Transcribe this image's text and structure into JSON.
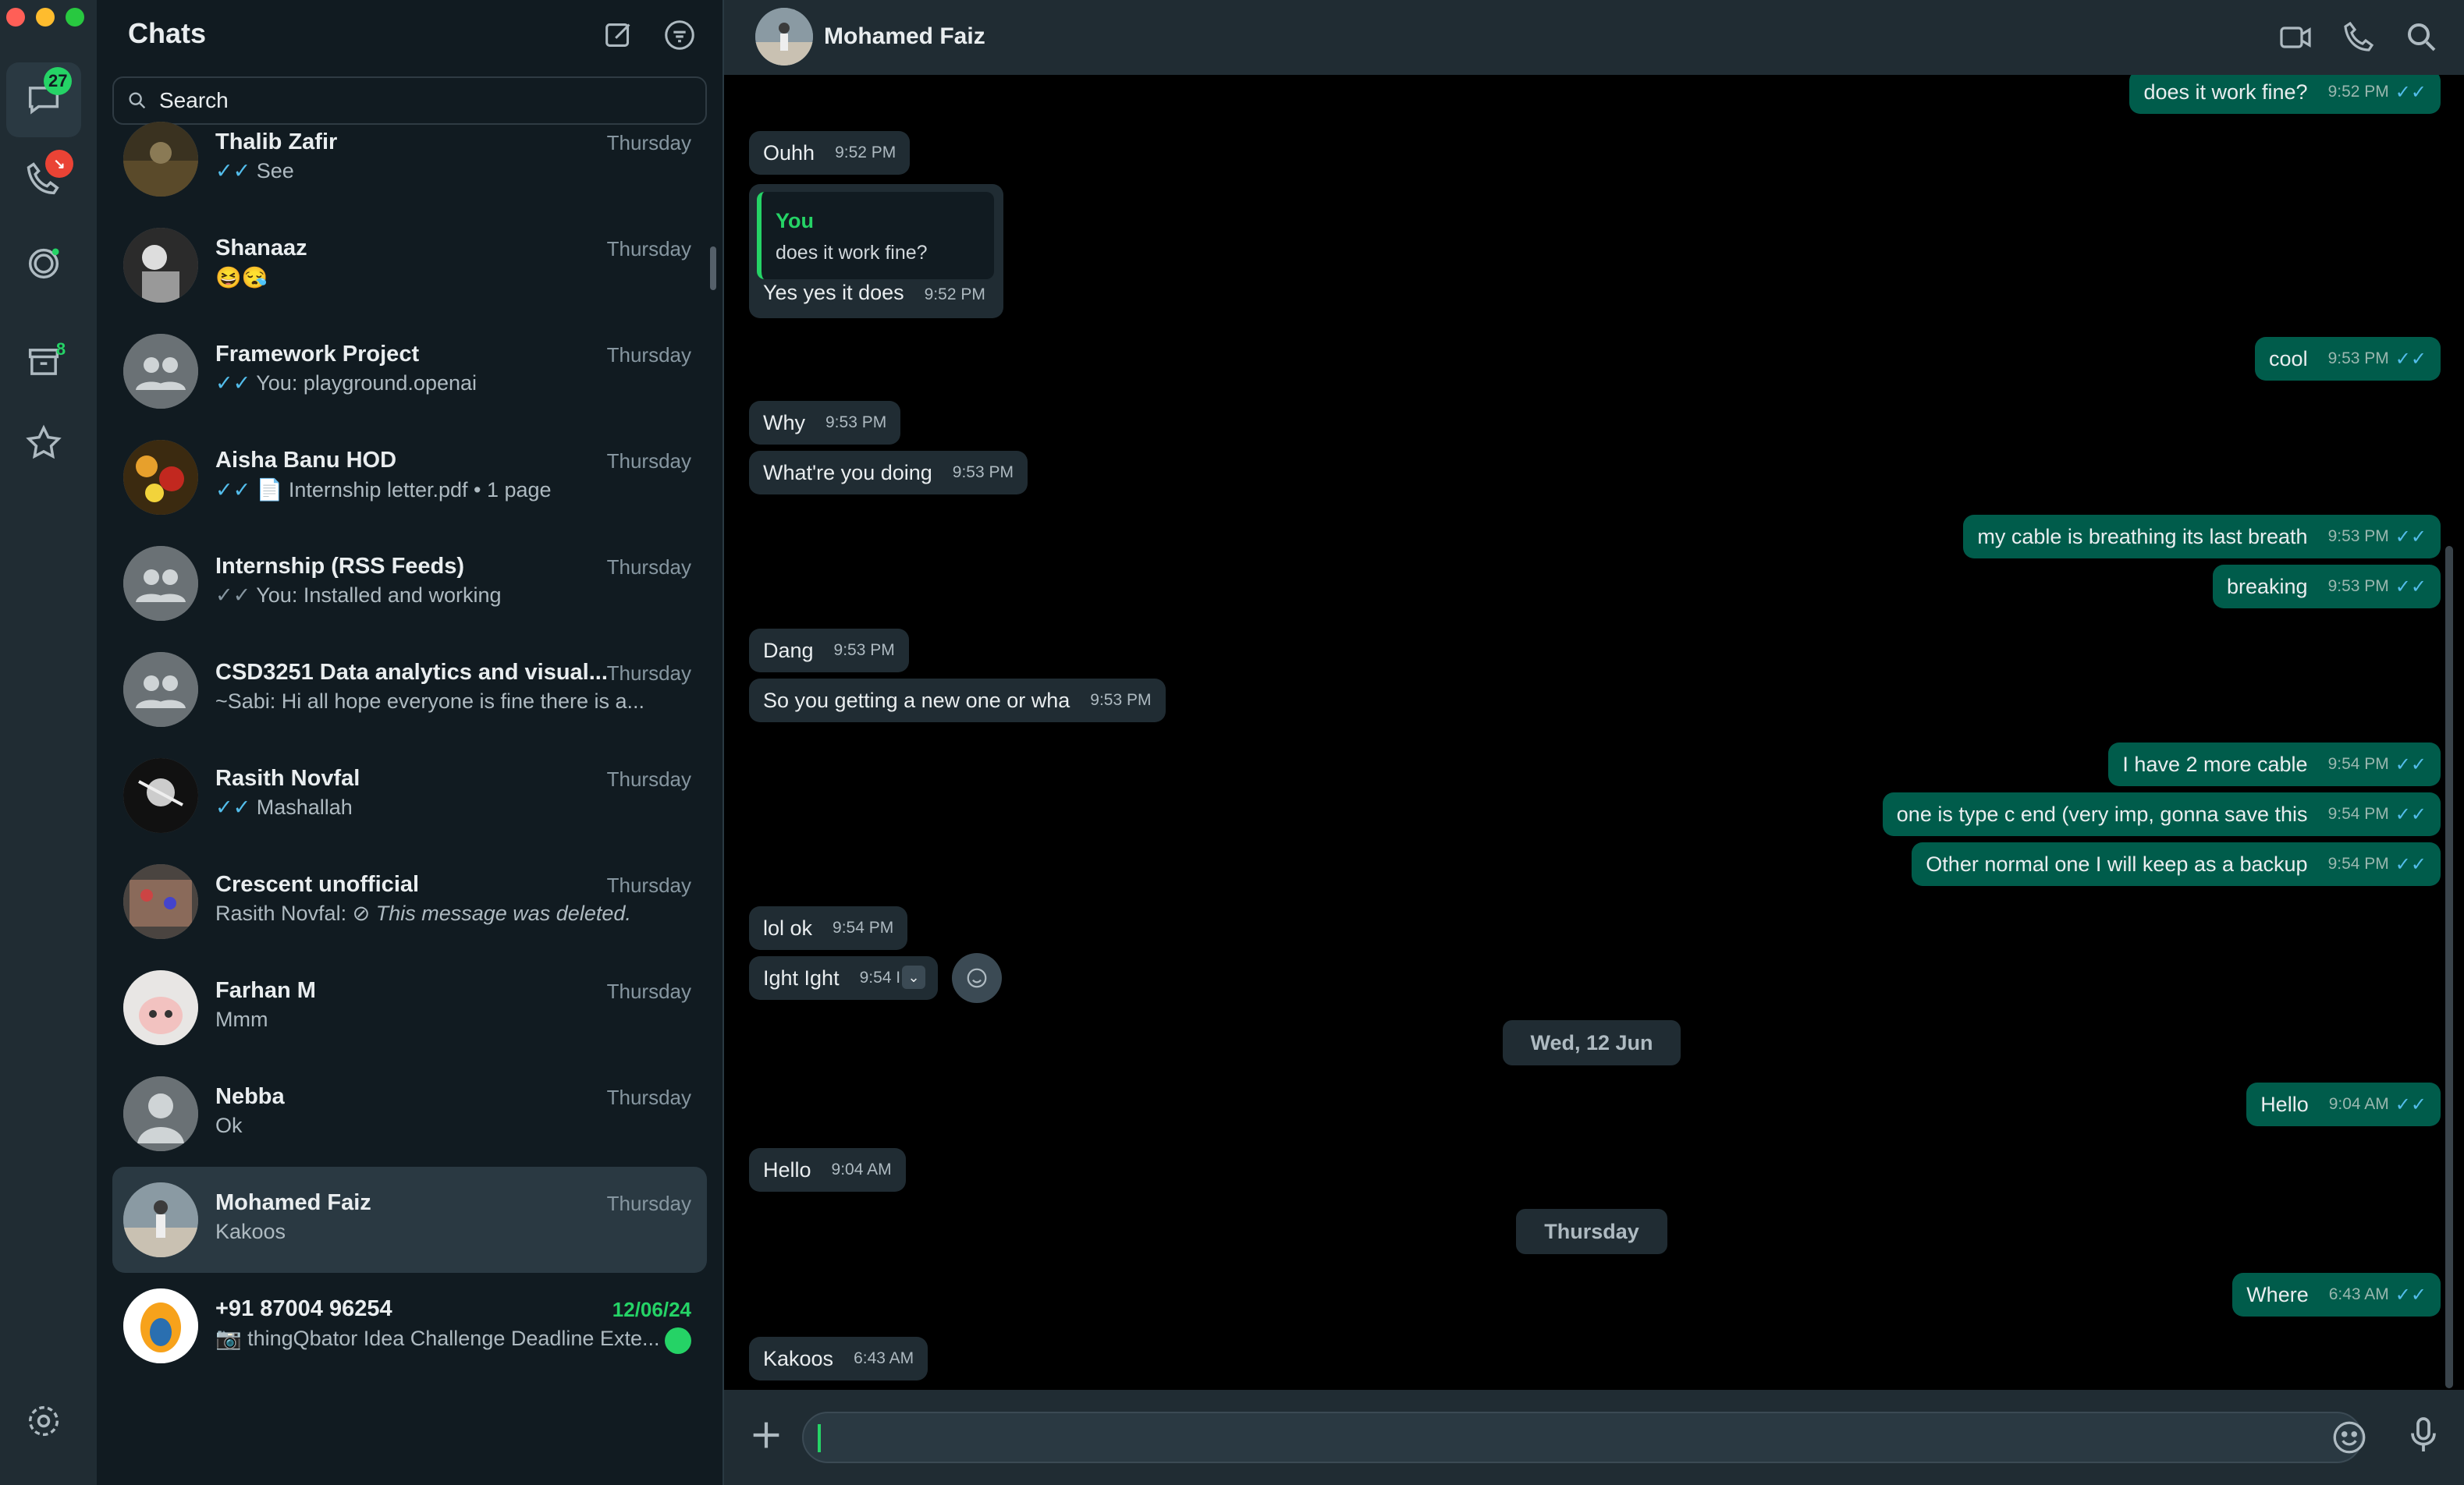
{
  "window": {
    "traffic_lights": [
      "#ff5f57",
      "#febc2e",
      "#28c840"
    ]
  },
  "rail": {
    "chats_badge": "27",
    "calls_badge": "↘",
    "archive_badge": "8",
    "items": [
      "chats-icon",
      "calls-icon",
      "status-icon",
      "archive-icon",
      "starred-icon",
      "settings-icon"
    ]
  },
  "list": {
    "title": "Chats",
    "search_placeholder": "Search",
    "chats": [
      {
        "name": "Thalib Zafir",
        "time": "Thursday",
        "tick": "✓✓",
        "tick_color": "blue",
        "preview": "See"
      },
      {
        "name": "Shanaaz",
        "time": "Thursday",
        "tick": "",
        "tick_color": "",
        "preview": "😆😪"
      },
      {
        "name": "Framework Project",
        "time": "Thursday",
        "tick": "✓✓",
        "tick_color": "blue",
        "preview": "You: playground.openai"
      },
      {
        "name": "Aisha Banu HOD",
        "time": "Thursday",
        "tick": "✓✓",
        "tick_color": "blue",
        "preview": "📄 Internship letter.pdf • 1 page"
      },
      {
        "name": "Internship (RSS Feeds)",
        "time": "Thursday",
        "tick": "✓✓",
        "tick_color": "grey",
        "preview": "You: Installed and working"
      },
      {
        "name": "CSD3251 Data analytics and visual...",
        "time": "Thursday",
        "tick": "",
        "tick_color": "",
        "preview": "~Sabi: Hi all hope everyone is fine there is a..."
      },
      {
        "name": "Rasith Novfal",
        "time": "Thursday",
        "tick": "✓✓",
        "tick_color": "blue",
        "preview": "Mashallah"
      },
      {
        "name": "Crescent unofficial",
        "time": "Thursday",
        "tick": "",
        "tick_color": "",
        "preview_prefix": "Rasith Novfal: ⊘ ",
        "preview": "This message was deleted."
      },
      {
        "name": "Farhan M",
        "time": "Thursday",
        "tick": "",
        "tick_color": "",
        "preview": "Mmm"
      },
      {
        "name": "Nebba",
        "time": "Thursday",
        "tick": "",
        "tick_color": "",
        "preview": "Ok"
      },
      {
        "name": "Mohamed Faiz",
        "time": "Thursday",
        "tick": "",
        "tick_color": "",
        "preview": "Kakoos"
      },
      {
        "name": "+91 87004 96254",
        "time": "12/06/24",
        "tick": "",
        "tick_color": "",
        "preview": "📷 thingQbator Idea Challenge Deadline Exte..."
      }
    ]
  },
  "conversation": {
    "contact_name": "Mohamed Faiz",
    "messages": [
      {
        "dir": "out",
        "text": "does it work fine?",
        "time": "9:52 PM"
      },
      {
        "dir": "in",
        "text": "Ouhh",
        "time": "9:52 PM"
      },
      {
        "dir": "in",
        "text": "Yes yes it does",
        "time": "9:52 PM",
        "quote_author": "You",
        "quote_text": "does it work fine?"
      },
      {
        "dir": "out",
        "text": "cool",
        "time": "9:53 PM"
      },
      {
        "dir": "in",
        "text": "Why",
        "time": "9:53 PM"
      },
      {
        "dir": "in",
        "text": "What're you doing",
        "time": "9:53 PM"
      },
      {
        "dir": "out",
        "text": "my cable is breathing its last breath",
        "time": "9:53 PM"
      },
      {
        "dir": "out",
        "text": "breaking",
        "time": "9:53 PM"
      },
      {
        "dir": "in",
        "text": "Dang",
        "time": "9:53 PM"
      },
      {
        "dir": "in",
        "text": "So you getting a new one or wha",
        "time": "9:53 PM"
      },
      {
        "dir": "out",
        "text": "I have 2 more cable",
        "time": "9:54 PM"
      },
      {
        "dir": "out",
        "text": "one is type c end (very imp, gonna save this",
        "time": "9:54 PM"
      },
      {
        "dir": "out",
        "text": "Other normal one I will keep as a backup",
        "time": "9:54 PM"
      },
      {
        "dir": "in",
        "text": "lol ok",
        "time": "9:54 PM"
      },
      {
        "dir": "in",
        "text": "Ight Ight",
        "time": "9:54 I"
      },
      {
        "dir": "date",
        "text": "Wed, 12 Jun"
      },
      {
        "dir": "out",
        "text": "Hello",
        "time": "9:04 AM"
      },
      {
        "dir": "in",
        "text": "Hello",
        "time": "9:04 AM"
      },
      {
        "dir": "date",
        "text": "Thursday"
      },
      {
        "dir": "out",
        "text": "Where",
        "time": "6:43 AM"
      },
      {
        "dir": "in",
        "text": "Kakoos",
        "time": "6:43 AM"
      }
    ],
    "ticks": "✓✓",
    "colors": {
      "outgoing": "#005c4b",
      "incoming": "#202c33",
      "read_tick": "#53bdeb",
      "accent": "#25d366"
    }
  },
  "composer": {
    "value": ""
  }
}
